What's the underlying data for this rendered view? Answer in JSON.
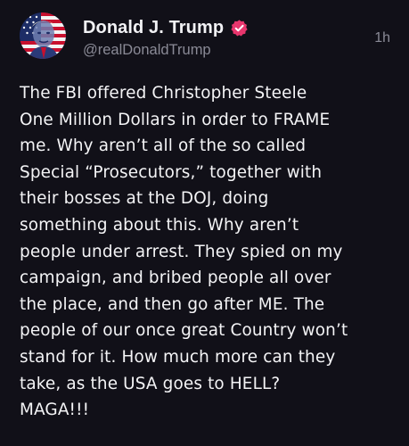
{
  "post": {
    "author": {
      "display_name": "Donald J. Trump",
      "handle": "@realDonaldTrump",
      "verified": true,
      "verified_badge_color": "#e8366d",
      "avatar_icon": "portrait-flag-avatar"
    },
    "timestamp": "1h",
    "text": "The FBI offered Christopher Steele\nOne Million Dollars in order to FRAME\nme. Why aren’t all of the so called\nSpecial “Prosecutors,” together with\ntheir bosses at the DOJ, doing\nsomething about this. Why aren’t\npeople under arrest. They spied on my\ncampaign, and bribed people all over\nthe place, and then go after ME. The\npeople of our once great Country won’t\nstand for it. How much more can they\ntake, as the USA goes to HELL?\nMAGA!!!"
  },
  "theme": {
    "background": "#111018",
    "primary_text": "#f4f4f6",
    "secondary_text": "#8a8a96"
  }
}
